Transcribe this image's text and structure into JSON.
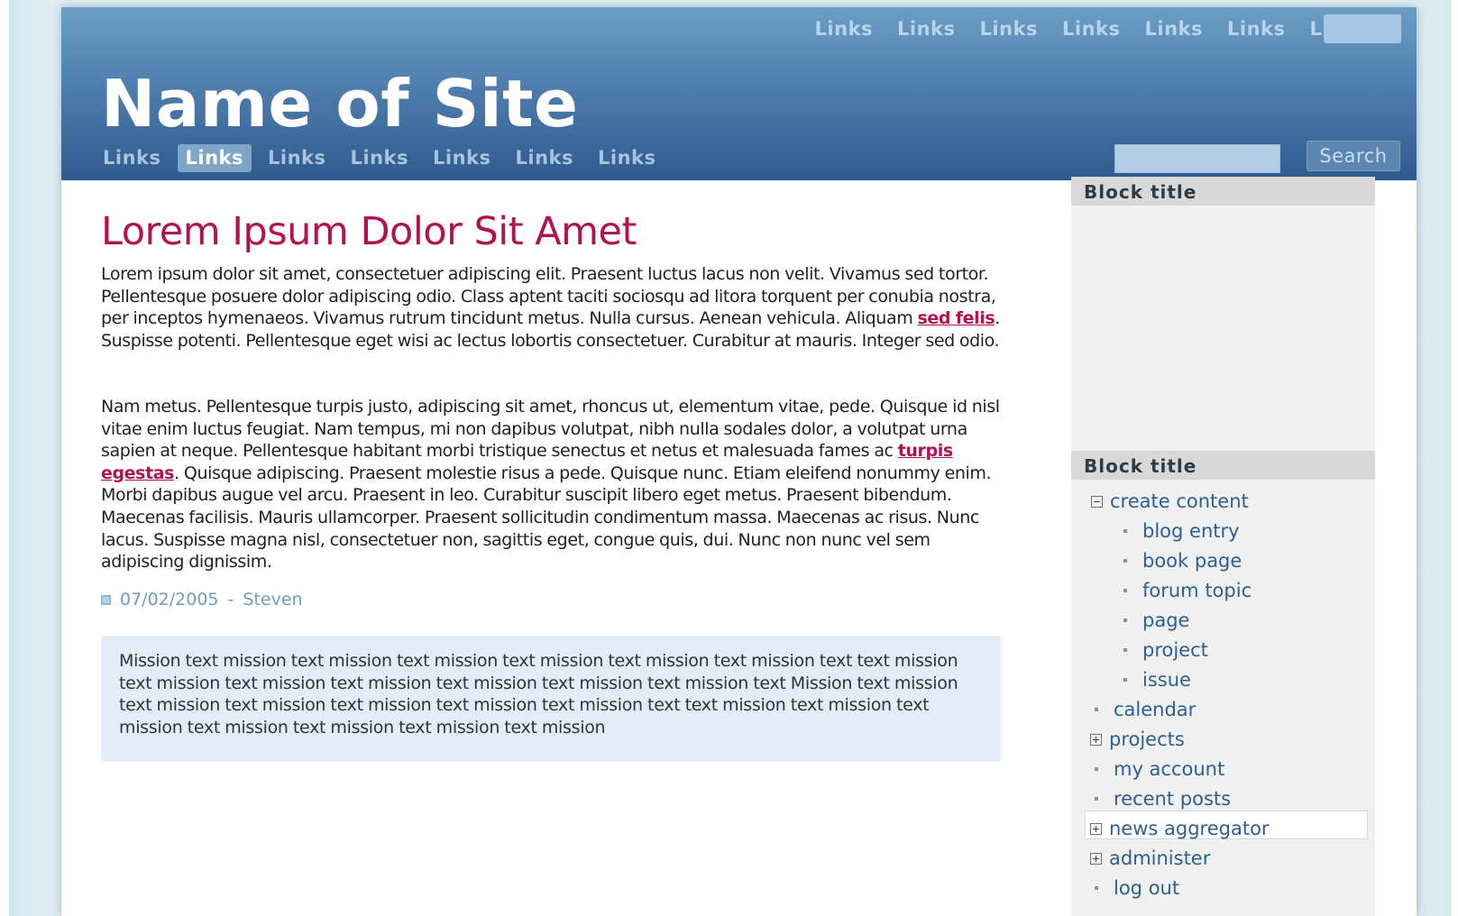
{
  "header": {
    "site_name": "Name of Site",
    "top_links": [
      "Links",
      "Links",
      "Links",
      "Links",
      "Links",
      "Links",
      "Links"
    ],
    "primary_links": [
      "Links",
      "Links",
      "Links",
      "Links",
      "Links",
      "Links",
      "Links"
    ],
    "active_primary_index": 1,
    "search": {
      "value": "",
      "button_label": "Search"
    }
  },
  "main": {
    "title": "Lorem Ipsum Dolor Sit Amet",
    "paragraph1": {
      "before": "Lorem ipsum dolor sit amet, consectetuer adipiscing elit. Praesent luctus lacus non velit. Vivamus sed tortor. Pellentesque posuere dolor adipiscing odio. Class aptent taciti sociosqu ad litora torquent per conubia nostra, per inceptos hymenaeos. Vivamus rutrum tincidunt metus. Nulla cursus. Aenean vehicula. Aliquam ",
      "highlight": "sed felis",
      "after": ". Suspisse potenti. Pellentesque eget wisi ac lectus lobortis consectetuer. Curabitur at mauris. Integer sed odio."
    },
    "paragraph2": {
      "before": "Nam metus. Pellentesque turpis justo, adipiscing sit amet, rhoncus ut, elementum vitae, pede. Quisque id nisl vitae enim luctus feugiat. Nam tempus, mi non dapibus volutpat, nibh nulla sodales dolor, a volutpat urna sapien at neque. Pellentesque habitant morbi tristique senectus et netus et malesuada fames ac ",
      "highlight": "turpis egestas",
      "after": ". Quisque adipiscing. Praesent molestie risus a pede. Quisque nunc. Etiam eleifend nonummy enim. Morbi dapibus augue vel arcu. Praesent in leo. Curabitur suscipit libero eget metus. Praesent bibendum. Maecenas facilisis. Mauris ullamcorper. Praesent sollicitudin condimentum massa. Maecenas ac risus. Nunc lacus. Suspisse magna nisl, consectetuer non, sagittis eget, congue quis, dui. Nunc non nunc vel sem adipiscing dignissim."
    },
    "meta": {
      "date": "07/02/2005",
      "separator": "-",
      "author": "Steven"
    },
    "mission_text": "Mission text mission text mission text mission text mission text mission text mission text text mission text mission text mission text mission text mission text mission text mission text Mission text mission text mission text mission text mission text mission text mission text text mission text mission text mission text mission text mission text mission text mission"
  },
  "sidebar": {
    "block1_title": "Block title",
    "block2_title": "Block title",
    "nav": {
      "create_content": "create content",
      "sub": [
        "blog entry",
        "book page",
        "forum topic",
        "page",
        "project",
        "issue"
      ],
      "calendar": "calendar",
      "projects": "projects",
      "my_account": "my account",
      "recent_posts": "recent posts",
      "news_aggregator": "news aggregator",
      "administer": "administer",
      "log_out": "log out"
    }
  },
  "colors": {
    "accent": "#b2124f",
    "header_top": "#6b9ec5",
    "header_bottom": "#2f5a8f",
    "link": "#2c5f95",
    "meta": "#6f9cc4"
  },
  "icons": {
    "meta": "calendar-icon",
    "collapse": "minus-box-icon",
    "expand": "plus-box-icon",
    "leaf": "bullet-icon"
  }
}
